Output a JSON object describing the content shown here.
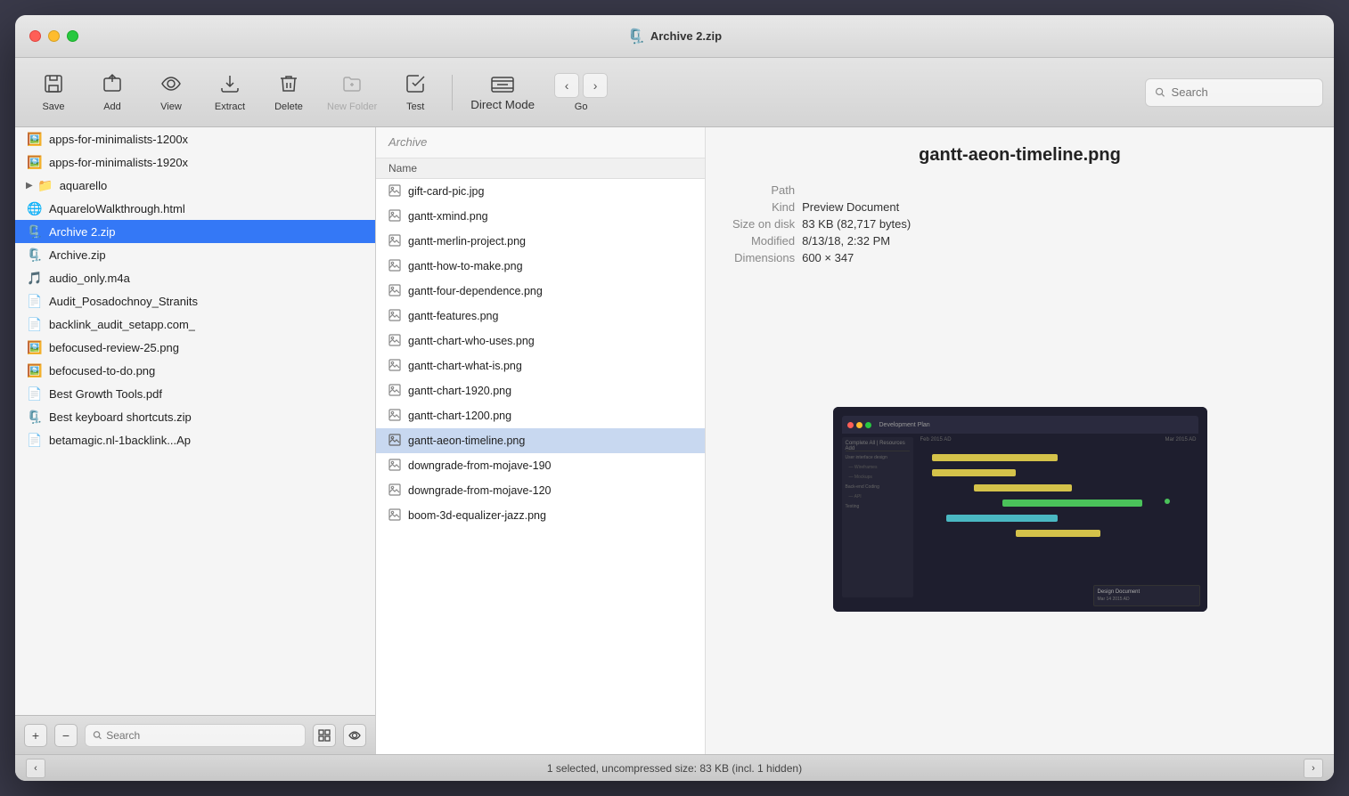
{
  "window": {
    "title": "Archive 2.zip",
    "icon": "🗜️"
  },
  "toolbar": {
    "save_label": "Save",
    "add_label": "Add",
    "view_label": "View",
    "extract_label": "Extract",
    "delete_label": "Delete",
    "new_folder_label": "New Folder",
    "test_label": "Test",
    "direct_mode_label": "Direct Mode",
    "go_label": "Go",
    "search_placeholder": "Search"
  },
  "left_panel": {
    "files": [
      {
        "name": "apps-for-minimalists-1200x",
        "icon": "🖼️",
        "indent": 0
      },
      {
        "name": "apps-for-minimalists-1920x",
        "icon": "🖼️",
        "indent": 0
      },
      {
        "name": "aquarello",
        "icon": "📁",
        "indent": 0,
        "expandable": true
      },
      {
        "name": "AquareloWalkthrough.html",
        "icon": "🌐",
        "indent": 0
      },
      {
        "name": "Archive 2.zip",
        "icon": "🗜️",
        "indent": 0,
        "selected": true
      },
      {
        "name": "Archive.zip",
        "icon": "🗜️",
        "indent": 0
      },
      {
        "name": "audio_only.m4a",
        "icon": "🎵",
        "indent": 0
      },
      {
        "name": "Audit_Posadochnoy_Stranits",
        "icon": "📄",
        "indent": 0,
        "pdf": true
      },
      {
        "name": "backlink_audit_setapp.com_",
        "icon": "📄",
        "indent": 0
      },
      {
        "name": "befocused-review-25.png",
        "icon": "🖼️",
        "indent": 0
      },
      {
        "name": "befocused-to-do.png",
        "icon": "🖼️",
        "indent": 0
      },
      {
        "name": "Best Growth Tools.pdf",
        "icon": "📄",
        "indent": 0,
        "pdf": true
      },
      {
        "name": "Best keyboard shortcuts.zip",
        "icon": "🗜️",
        "indent": 0
      },
      {
        "name": "betamagic.nl-1backlink...Ap",
        "icon": "📄",
        "indent": 0
      }
    ],
    "bottom_search_placeholder": "Search"
  },
  "archive_panel": {
    "header_title": "Archive",
    "column_header": "Name",
    "files": [
      {
        "name": "gift-card-pic.jpg",
        "icon": "img"
      },
      {
        "name": "gantt-xmind.png",
        "icon": "img"
      },
      {
        "name": "gantt-merlin-project.png",
        "icon": "img"
      },
      {
        "name": "gantt-how-to-make.png",
        "icon": "img"
      },
      {
        "name": "gantt-four-dependence.png",
        "icon": "img"
      },
      {
        "name": "gantt-features.png",
        "icon": "img"
      },
      {
        "name": "gantt-chart-who-uses.png",
        "icon": "img"
      },
      {
        "name": "gantt-chart-what-is.png",
        "icon": "img"
      },
      {
        "name": "gantt-chart-1920.png",
        "icon": "img"
      },
      {
        "name": "gantt-chart-1200.png",
        "icon": "img"
      },
      {
        "name": "gantt-aeon-timeline.png",
        "icon": "img",
        "selected": true
      },
      {
        "name": "downgrade-from-mojave-190",
        "icon": "img"
      },
      {
        "name": "downgrade-from-mojave-120",
        "icon": "img"
      },
      {
        "name": "boom-3d-equalizer-jazz.png",
        "icon": "img"
      }
    ]
  },
  "preview": {
    "filename": "gantt-aeon-timeline.png",
    "path_label": "Path",
    "path_value": "",
    "kind_label": "Kind",
    "kind_value": "Preview Document",
    "size_label": "Size on disk",
    "size_value": "83 KB (82,717 bytes)",
    "modified_label": "Modified",
    "modified_value": "8/13/18, 2:32 PM",
    "dimensions_label": "Dimensions",
    "dimensions_value": "600 × 347"
  },
  "status_bar": {
    "text": "1 selected, uncompressed size: 83 KB (incl. 1 hidden)"
  },
  "colors": {
    "selection_blue": "#3478f6",
    "archive_selection": "#c8d8f0"
  }
}
